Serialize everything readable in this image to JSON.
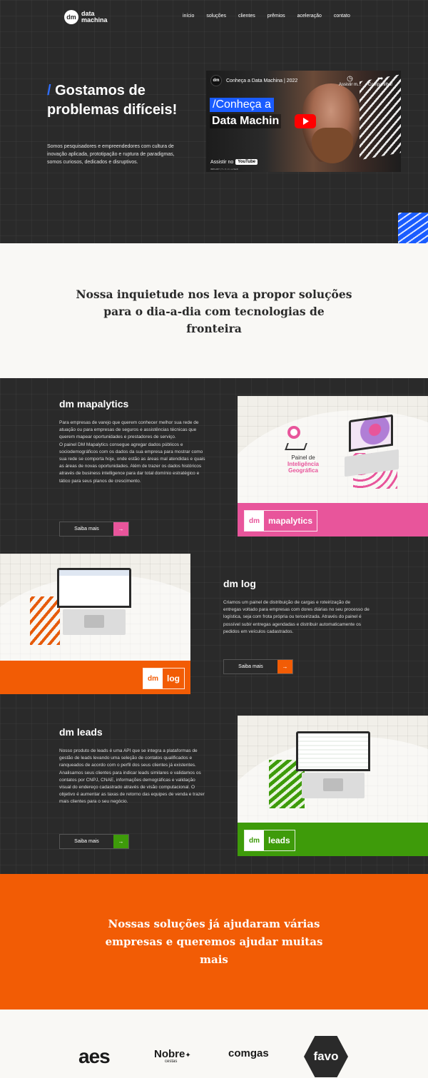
{
  "header": {
    "logo": {
      "mark": "dm",
      "line1": "data",
      "line2": "machina"
    },
    "nav": [
      {
        "label": "início"
      },
      {
        "label": "soluções"
      },
      {
        "label": "clientes"
      },
      {
        "label": "prêmios"
      },
      {
        "label": "aceleração"
      },
      {
        "label": "contato"
      }
    ]
  },
  "hero": {
    "slash": "/",
    "title": "Gostamos de problemas difíceis!",
    "description": "Somos pesquisadores e empreendedores com cultura de inovação aplicada, prototipação e ruptura de paradigmas, somos curiosos, dedicados e disruptivos."
  },
  "video": {
    "channel_avatar": "dm",
    "title": "Conheça a Data Machina | 2022",
    "watch_later": "Assistir m...",
    "share": "Compartilhar",
    "overlay_line1": "/Conheça a",
    "overlay_line2": "Data Machin",
    "watch_on": "Assistir no",
    "youtube": "YouTube",
    "credit": "IMPLANT | T • V • C • a Verdi"
  },
  "tagline": "Nossa inquietude nos leva a propor soluções para o dia-a-dia com tecnologias de fronteira",
  "products": [
    {
      "title": "dm mapalytics",
      "paragraphs": [
        "Para empresas de varejo que querem conhecer melhor sua rede de atuação ou para empresas de seguros e assistências técnicas que querem mapear oportunidades e prestadores de serviço.",
        "O painel DM Mapalytics consegue agregar dados públicos e sociodemográficos com os dados da sua empresa para mostrar como sua rede se comporta hoje, onde estão as áreas mal atendidas e quais as áreas de novas oportunidades. Além de trazer os dados históricos através de business intelligence para dar total domínio estratégico e tático para seus planos de crescimento."
      ],
      "button": "Saiba mais",
      "arrow": "→",
      "accent": "#e8559b",
      "badge_dm": "dm",
      "badge_name": "mapalytics",
      "panel_line1": "Painel de",
      "panel_line2": "Inteligência",
      "panel_line3": "Geográfica"
    },
    {
      "title": "dm log",
      "paragraphs": [
        "Criamos um painel de distribuição de cargas e roteirização de entregas voltado para empresas com dores diárias no seu processo de logística, seja com frota própria ou terceirizada. Através do painel é possível subir entregas agendadas e distribuir automaticamente os pedidos em veículos cadastrados."
      ],
      "button": "Saiba mais",
      "arrow": "→",
      "accent": "#f25c05",
      "badge_dm": "dm",
      "badge_name": "log"
    },
    {
      "title": "dm leads",
      "paragraphs": [
        "Nosso produto de leads é uma API que se integra a plataformas de gestão de leads levando uma seleção de contatos qualificados e ranqueados de acordo com o perfil dos seus clientes já existentes. Analisamos seus clientes para indicar leads similares e validamos os contatos por CNPJ, CNAE, informações demográficas e validação visual do endereço cadastrado através de visão computacional. O objetivo é aumentar as taxas de retorno das equipes de venda e trazer mais clientes para o seu negócio."
      ],
      "button": "Saiba mais",
      "arrow": "→",
      "accent": "#3e9b0a",
      "badge_dm": "dm",
      "badge_name": "leads"
    }
  ],
  "cta": "Nossas soluções já ajudaram várias empresas e queremos ajudar muitas mais",
  "clients": {
    "aes": "aes",
    "nobre": "Nobre",
    "nobre_sub": "cestas",
    "comgos": "comgas",
    "favo": "favo"
  },
  "colors": {
    "dark": "#2a2a2a",
    "blue": "#1a5cff",
    "orange": "#f25c05",
    "pink": "#e8559b",
    "green": "#3e9b0a",
    "light": "#f9f8f5"
  }
}
